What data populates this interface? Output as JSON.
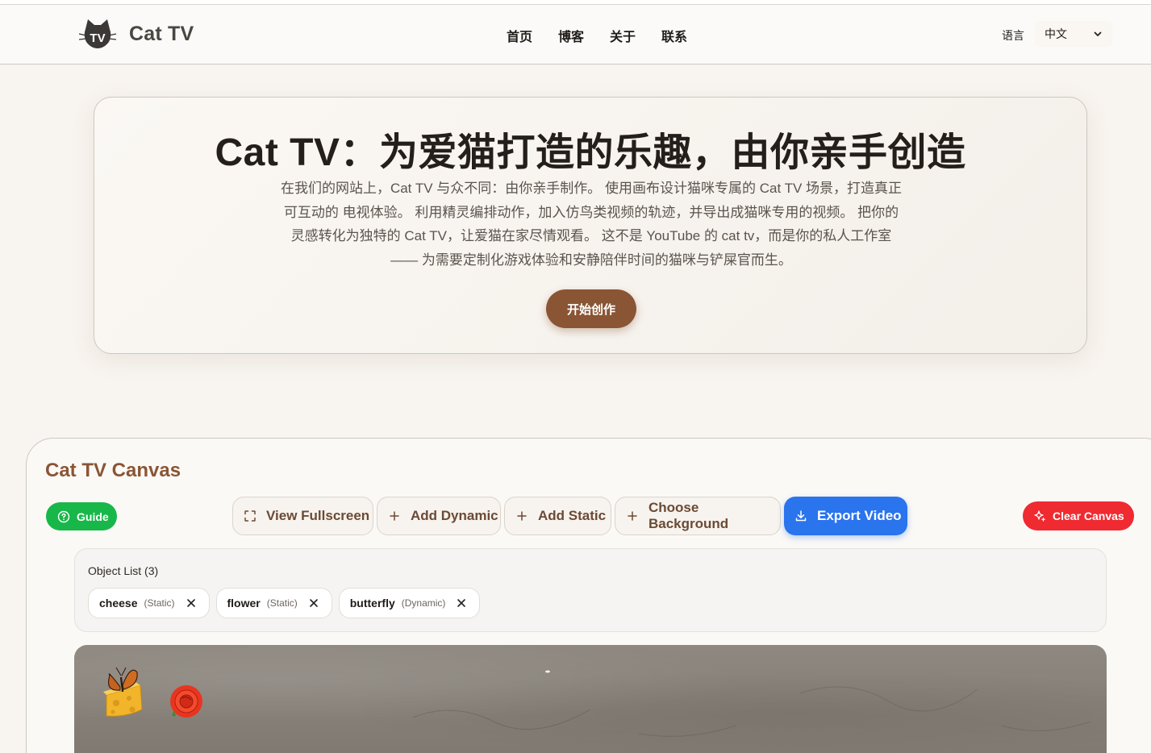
{
  "header": {
    "logo_badge": "TV",
    "brand": "Cat TV",
    "nav": [
      {
        "label": "首页"
      },
      {
        "label": "博客"
      },
      {
        "label": "关于"
      },
      {
        "label": "联系"
      }
    ],
    "language_label": "语言",
    "language_value": "中文"
  },
  "hero": {
    "title": "Cat TV：为爱猫打造的乐趣，由你亲手创造",
    "description": "在我们的网站上，Cat TV 与众不同：由你亲手制作。 使用画布设计猫咪专属的 Cat TV 场景，打造真正可互动的 电视体验。 利用精灵编排动作，加入仿鸟类视频的轨迹，并导出成猫咪专用的视频。 把你的灵感转化为独特的 Cat TV，让爱猫在家尽情观看。 这不是 YouTube 的 cat tv，而是你的私人工作室—— 为需要定制化游戏体验和安静陪伴时间的猫咪与铲屎官而生。",
    "cta": "开始创作"
  },
  "canvas": {
    "title": "Cat TV Canvas",
    "guide": "Guide",
    "toolbar": {
      "fullscreen": "View Fullscreen",
      "add_dynamic": "Add Dynamic",
      "add_static": "Add Static",
      "background": "Choose Background",
      "export": "Export Video",
      "clear": "Clear Canvas"
    },
    "object_list": {
      "title": "Object List (3)",
      "items": [
        {
          "name": "cheese",
          "type": "(Static)"
        },
        {
          "name": "flower",
          "type": "(Static)"
        },
        {
          "name": "butterfly",
          "type": "(Dynamic)"
        }
      ]
    }
  },
  "colors": {
    "brand_brown": "#8a5535",
    "guide_green": "#18b74a",
    "export_blue": "#2a74ee",
    "clear_red": "#ef2a31"
  },
  "icons": [
    "cat-logo-icon",
    "chevron-down-icon",
    "help-circle-icon",
    "fullscreen-icon",
    "plus-icon",
    "download-icon",
    "sparkle-icon",
    "close-icon"
  ]
}
